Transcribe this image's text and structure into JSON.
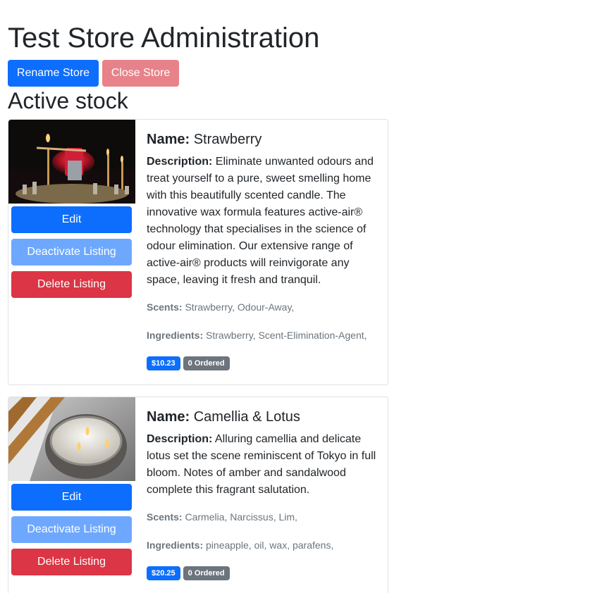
{
  "header": {
    "title": "Test Store Administration",
    "rename_label": "Rename Store",
    "close_label": "Close Store"
  },
  "section_title": "Active stock",
  "colors": {
    "primary": "#0d6efd",
    "primary_light": "#6ea8fe",
    "danger": "#dc3545",
    "danger_light": "#e8828a",
    "secondary": "#6c757d"
  },
  "labels": {
    "name": "Name:",
    "description": "Description:",
    "scents": "Scents:",
    "ingredients": "Ingredients:",
    "edit": "Edit",
    "deactivate": "Deactivate Listing",
    "delete": "Delete Listing"
  },
  "products": [
    {
      "name": "Strawberry",
      "description": "Eliminate unwanted odours and treat yourself to a pure, sweet smelling home with this beautifully scented candle. The innovative wax formula features active-air® technology that specialises in the science of odour elimination. Our extensive range of active-air® products will reinvigorate any space, leaving it fresh and tranquil.",
      "scents": "Strawberry, Odour-Away,",
      "ingredients": "Strawberry, Scent-Elimination-Agent,",
      "price": "$10.23",
      "ordered": "0 Ordered"
    },
    {
      "name": "Camellia & Lotus",
      "description": "Alluring camellia and delicate lotus set the scene reminiscent of Tokyo in full bloom. Notes of amber and sandalwood complete this fragrant salutation.",
      "scents": "Carmelia, Narcissus, Lim,",
      "ingredients": "pineapple, oil, wax, parafens,",
      "price": "$20.25",
      "ordered": "0 Ordered"
    }
  ]
}
